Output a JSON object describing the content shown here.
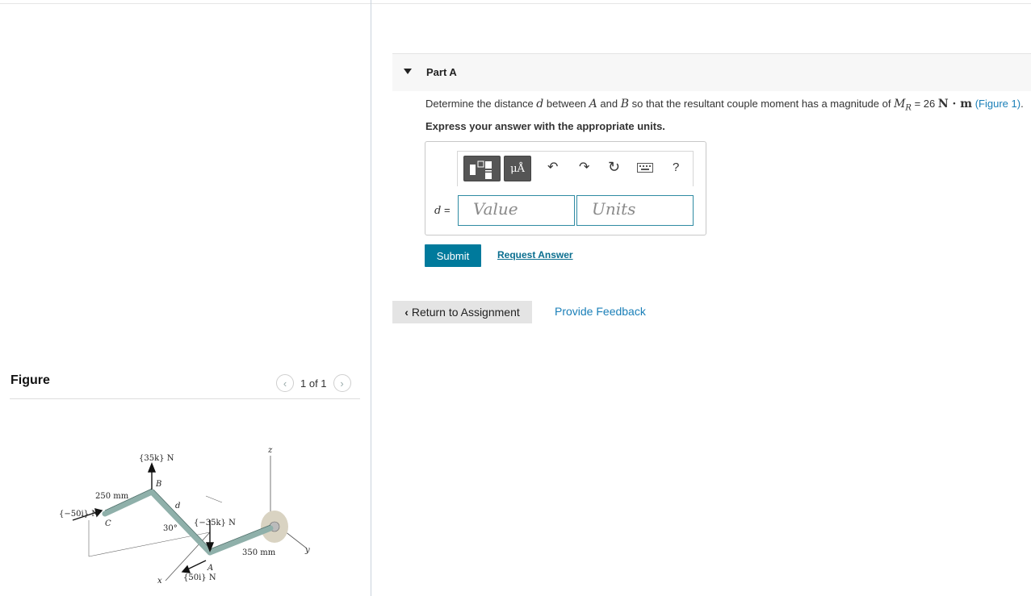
{
  "figure_pane": {
    "title": "Figure",
    "pager_text": "1 of 1",
    "labels": {
      "force_k_up": "{35k} N",
      "force_i_left": "{−50i} N",
      "force_k_down": "{−35k} N",
      "force_i_right": "{50i} N",
      "dim_250": "250 mm",
      "dim_350": "350 mm",
      "angle": "30°",
      "d": "d",
      "A": "A",
      "B": "B",
      "C": "C",
      "x": "x",
      "y": "y",
      "z": "z"
    }
  },
  "part": {
    "label": "Part A",
    "prompt_before_d": "Determine the distance ",
    "d_symbol": "d",
    "between": " between ",
    "A": "A",
    "and": " and ",
    "B": "B",
    "prompt_mid": " so that the resultant couple moment has a magnitude of ",
    "M": "M",
    "R": "R",
    "value": " = 26 ",
    "unit": "N · m",
    "figure_link": "(Figure 1)",
    "period": ".",
    "instruction": "Express your answer with the appropriate units."
  },
  "answer": {
    "variable_label": "d",
    "equals": " =",
    "value_placeholder": "Value",
    "units_placeholder": "Units",
    "toolbar": {
      "units_button": "μÅ",
      "help": "?"
    }
  },
  "actions": {
    "submit": "Submit",
    "request_answer": "Request Answer",
    "return": "Return to Assignment",
    "feedback": "Provide Feedback"
  }
}
